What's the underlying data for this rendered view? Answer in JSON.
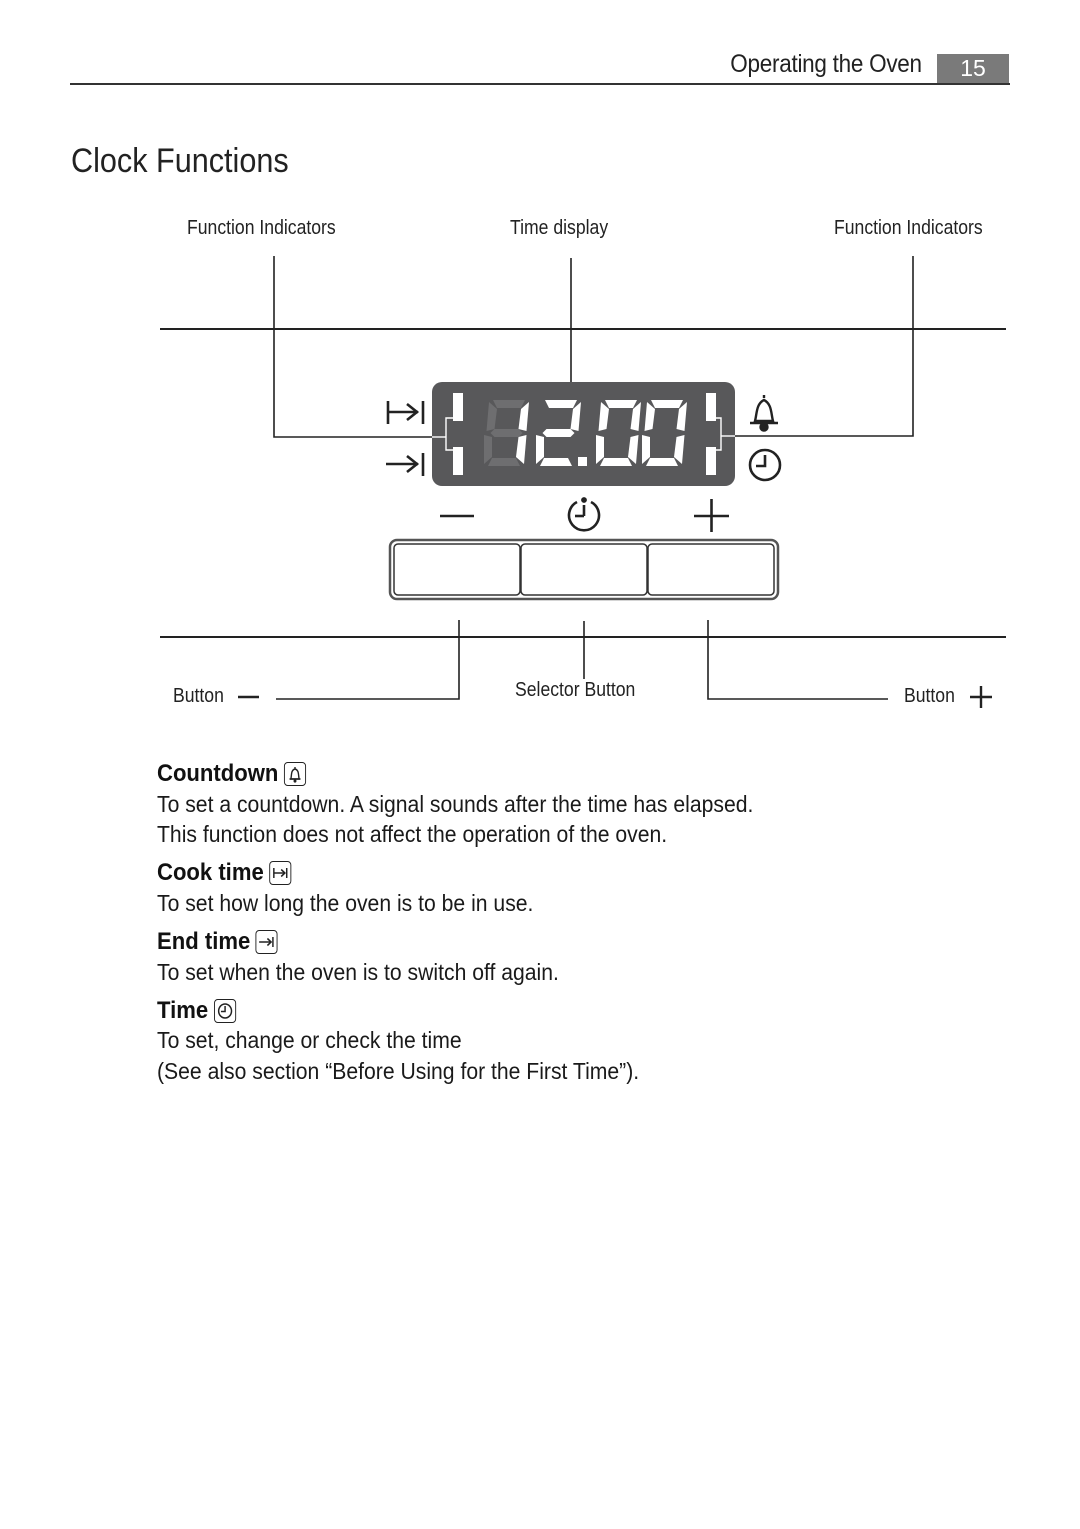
{
  "header": {
    "section": "Operating the Oven",
    "page_number": "15"
  },
  "page_title": "Clock Functions",
  "diagram": {
    "callouts": {
      "function_indicators_left": "Function Indicators",
      "time_display": "Time display",
      "function_indicators_right": "Function Indicators",
      "button_minus": "Button",
      "selector_button": "Selector Button",
      "button_plus": "Button"
    },
    "display": {
      "time": "12.00",
      "leading_digit_dim": "8",
      "left_indicators": [
        "cook-time-icon",
        "end-time-icon"
      ],
      "right_indicators": [
        "countdown-bell-icon",
        "clock-icon"
      ]
    },
    "buttons": [
      {
        "name": "minus",
        "symbol": "minus-icon"
      },
      {
        "name": "selector",
        "symbol": "clock-selector-icon"
      },
      {
        "name": "plus",
        "symbol": "plus-icon"
      }
    ],
    "colors": {
      "display_bg": "#58585a",
      "segment_on": "#ffffff",
      "segment_off": "#6e6e70"
    }
  },
  "functions": [
    {
      "title": "Countdown",
      "icon": "bell-icon",
      "lines": [
        "To set a countdown. A signal sounds after the time has elapsed.",
        "This function does not affect the operation of the oven."
      ]
    },
    {
      "title": "Cook time",
      "icon": "cook-time-icon",
      "lines": [
        "To set how long the oven is to be in use."
      ]
    },
    {
      "title": "End time",
      "icon": "end-time-icon",
      "lines": [
        "To set when the oven is to switch off again."
      ]
    },
    {
      "title": "Time",
      "icon": "clock-icon",
      "lines": [
        "To set, change or check the time",
        "(See also section “Before Using for the First Time”)."
      ]
    }
  ]
}
